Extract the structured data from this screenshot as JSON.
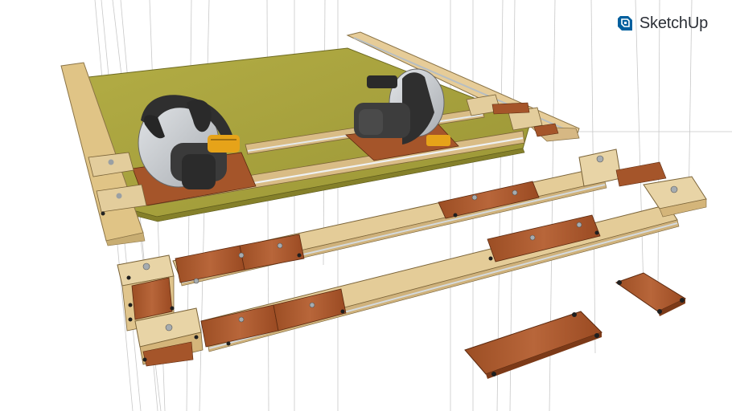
{
  "brand": {
    "name": "SketchUp",
    "logo_icon": "sketchup-logo-icon",
    "accent_color": "#005f9e"
  },
  "scene": {
    "description_icons": [
      "circular-saw-icon",
      "guide-rail-icon",
      "plywood-sheet-icon",
      "rail-connector-block-icon"
    ],
    "colors": {
      "plywood": "#a7a23a",
      "particle_board": "#e2c88a",
      "light_wood": "#e4cc98",
      "dark_wood": "#a5552a",
      "aluminum": "#d6dcdf",
      "saw_body": "#3a3a3a",
      "blade": "#c6c9cc"
    }
  }
}
